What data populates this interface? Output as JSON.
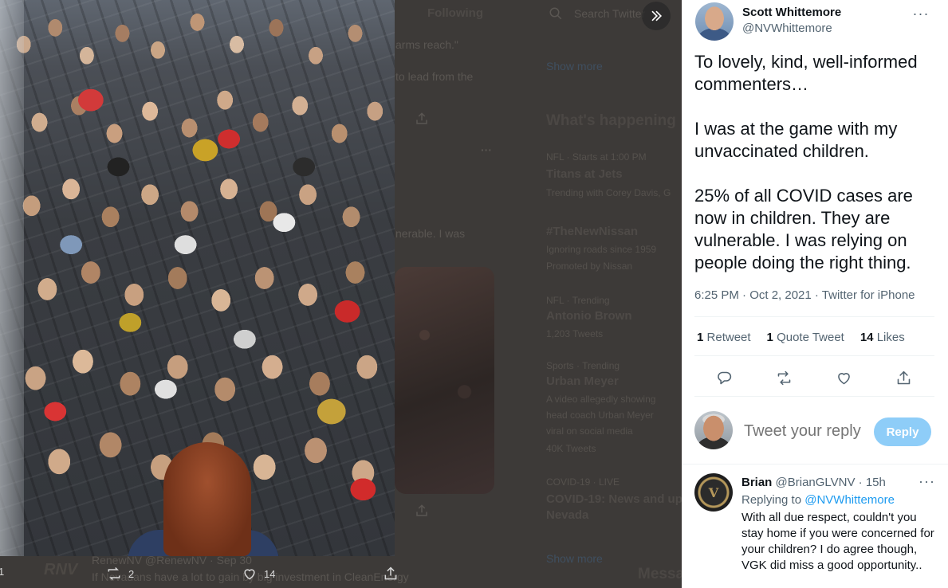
{
  "background": {
    "following_tab": "Following",
    "search_placeholder": "Search Twitter",
    "arms_reach_fragment": "arms reach.\"",
    "lead_fragment": "to lead from the",
    "vulnerable_fragment": "nerable. I was",
    "show_more_top": "Show more",
    "whats_happening": "What's happening",
    "trends": [
      {
        "context": "NFL · Starts at 1:00 PM",
        "title": "Titans at Jets",
        "sub": "Trending with Corey Davis, G"
      },
      {
        "context": "",
        "title": "#TheNewNissan",
        "sub": "Ignoring roads since 1959",
        "promo": "Promoted by Nissan"
      },
      {
        "context": "NFL · Trending",
        "title": "Antonio Brown",
        "sub": "1,203 Tweets"
      },
      {
        "context": "Sports · Trending",
        "title": "Urban Meyer",
        "sub": "A video allegedly showing",
        "sub2": "head coach Urban Meyer",
        "sub3": "viral on social media",
        "count": "40K Tweets"
      },
      {
        "context": "COVID-19 · LIVE",
        "title": "COVID-19: News and up",
        "title2": "Nevada"
      }
    ],
    "show_more_bottom": "Show more",
    "messages_label": "Messa",
    "bottom_tweet_author": "RenewNV @RenewNV · Sep 30",
    "bottom_tweet_text": "If Nevadans have a lot to gain by big investment in CleanEnergy",
    "bottom_logo_text": "RNV",
    "bottom_actions": {
      "reply_count": "1",
      "retweet_count": "2",
      "like_count": "14"
    }
  },
  "tweet": {
    "author_name": "Scott Whittemore",
    "author_handle": "@NVWhittemore",
    "paragraphs": [
      "To lovely, kind, well-informed commenters…",
      "I was at the game with my unvaccinated children.",
      "25% of all COVID cases are now in children. They are vulnerable. I was relying on people doing the right thing."
    ],
    "meta": "6:25 PM · Oct 2, 2021 · Twitter for iPhone",
    "stats": {
      "retweets_count": "1",
      "retweets_label": "Retweet",
      "quotes_count": "1",
      "quotes_label": "Quote Tweet",
      "likes_count": "14",
      "likes_label": "Likes"
    }
  },
  "reply_box": {
    "placeholder": "Tweet your reply",
    "button_label": "Reply"
  },
  "reply": {
    "name": "Brian",
    "handle_time": "@BrianGLVNV · 15h",
    "replying_to_label": "Replying to",
    "replying_to_handle": "@NVWhittemore",
    "text": "With all due respect, couldn't you stay home if you were concerned for your children? I do agree though, VGK did miss a good opportunity..",
    "avatar_text": "V"
  },
  "colors": {
    "accent": "#1d9bf0",
    "reply_button": "#8ecdf8",
    "secondary_text": "#536471"
  }
}
